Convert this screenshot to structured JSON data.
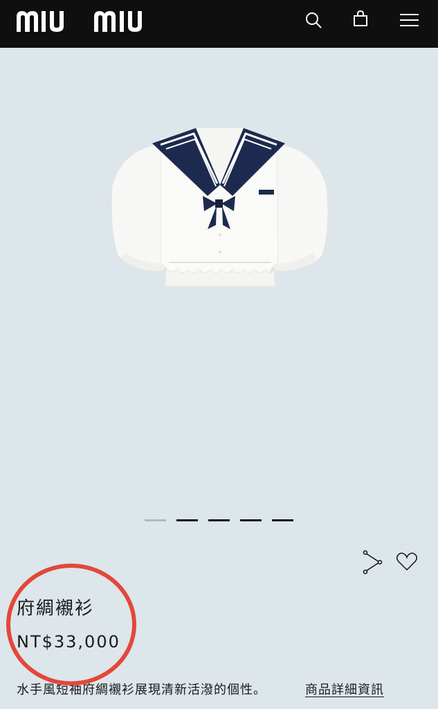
{
  "header": {
    "logo": "miu miu",
    "icons": [
      "search-icon",
      "shopping-bag-icon",
      "menu-icon"
    ]
  },
  "carousel": {
    "slide_count": 5,
    "active_index": 0
  },
  "product": {
    "name": "府綢襯衫",
    "price": "NT$33,000",
    "description": "水手風短袖府綢襯衫展現清新活潑的個性。",
    "details_link": "商品詳細資訊"
  },
  "actions": {
    "icons": [
      "share-icon",
      "wishlist-heart-icon"
    ]
  },
  "colors": {
    "background": "#dde6ea",
    "header": "#0f0f0f",
    "annotation_circle": "#e2483a",
    "navy": "#1d2a4f"
  }
}
